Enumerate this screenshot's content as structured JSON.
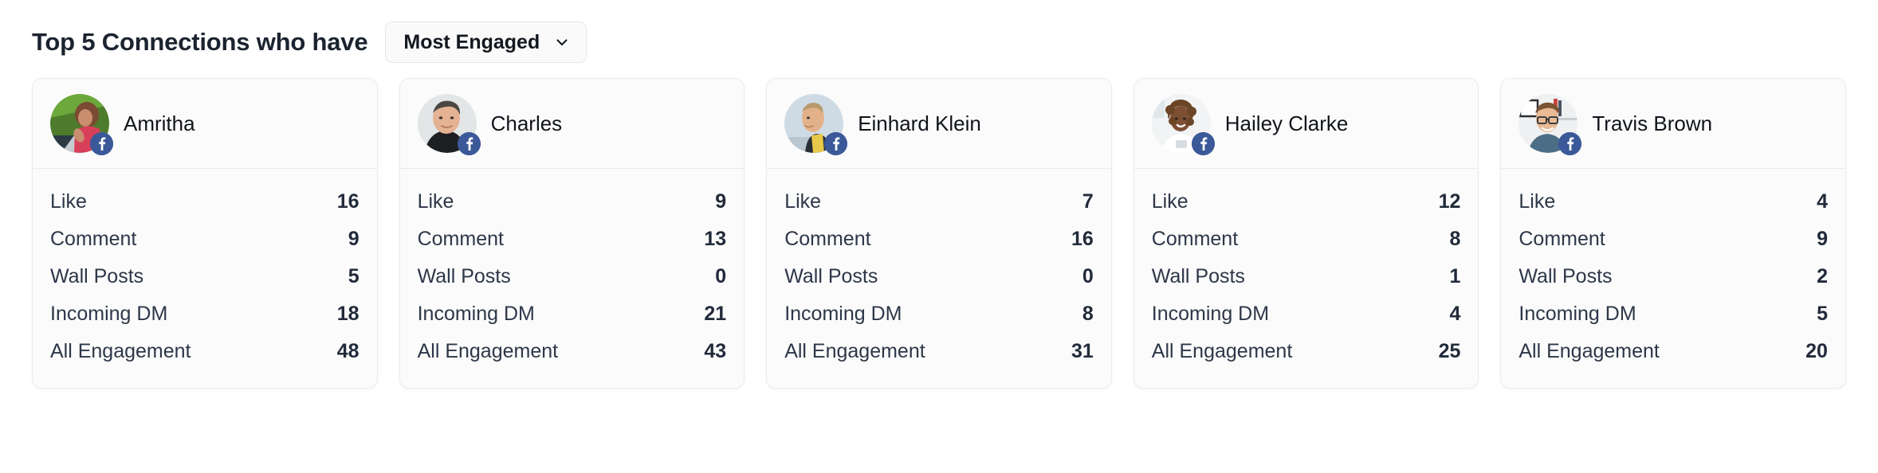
{
  "header": {
    "title": "Top 5 Connections who have",
    "dropdown": {
      "selected": "Most Engaged",
      "icon": "chevron-down-icon"
    }
  },
  "colors": {
    "page_background": "#ffffff",
    "card_background": "#fbfbfb",
    "card_border": "#ebecee",
    "title_text": "#1b2330",
    "label_text": "#2d3748",
    "value_text": "#222b3a",
    "facebook_badge": "#3b5998",
    "dropdown_background": "#fafafa"
  },
  "stat_labels": [
    "Like",
    "Comment",
    "Wall Posts",
    "Incoming DM",
    "All Engagement"
  ],
  "cards": [
    {
      "name": "Amritha",
      "network_badge": "facebook-icon",
      "avatar": "avatar-photo-amritha",
      "stats": [
        {
          "label": "Like",
          "value": "16"
        },
        {
          "label": "Comment",
          "value": "9"
        },
        {
          "label": "Wall Posts",
          "value": "5"
        },
        {
          "label": "Incoming DM",
          "value": "18"
        },
        {
          "label": "All Engagement",
          "value": "48"
        }
      ]
    },
    {
      "name": "Charles",
      "network_badge": "facebook-icon",
      "avatar": "avatar-photo-charles",
      "stats": [
        {
          "label": "Like",
          "value": "9"
        },
        {
          "label": "Comment",
          "value": "13"
        },
        {
          "label": "Wall Posts",
          "value": "0"
        },
        {
          "label": "Incoming DM",
          "value": "21"
        },
        {
          "label": "All Engagement",
          "value": "43"
        }
      ]
    },
    {
      "name": "Einhard Klein",
      "network_badge": "facebook-icon",
      "avatar": "avatar-photo-einhard-klein",
      "stats": [
        {
          "label": "Like",
          "value": "7"
        },
        {
          "label": "Comment",
          "value": "16"
        },
        {
          "label": "Wall Posts",
          "value": "0"
        },
        {
          "label": "Incoming DM",
          "value": "8"
        },
        {
          "label": "All Engagement",
          "value": "31"
        }
      ]
    },
    {
      "name": "Hailey Clarke",
      "network_badge": "facebook-icon",
      "avatar": "avatar-photo-hailey-clarke",
      "stats": [
        {
          "label": "Like",
          "value": "12"
        },
        {
          "label": "Comment",
          "value": "8"
        },
        {
          "label": "Wall Posts",
          "value": "1"
        },
        {
          "label": "Incoming DM",
          "value": "4"
        },
        {
          "label": "All Engagement",
          "value": "25"
        }
      ]
    },
    {
      "name": "Travis Brown",
      "network_badge": "facebook-icon",
      "avatar": "avatar-photo-travis-brown",
      "stats": [
        {
          "label": "Like",
          "value": "4"
        },
        {
          "label": "Comment",
          "value": "9"
        },
        {
          "label": "Wall Posts",
          "value": "2"
        },
        {
          "label": "Incoming DM",
          "value": "5"
        },
        {
          "label": "All Engagement",
          "value": "20"
        }
      ]
    }
  ]
}
